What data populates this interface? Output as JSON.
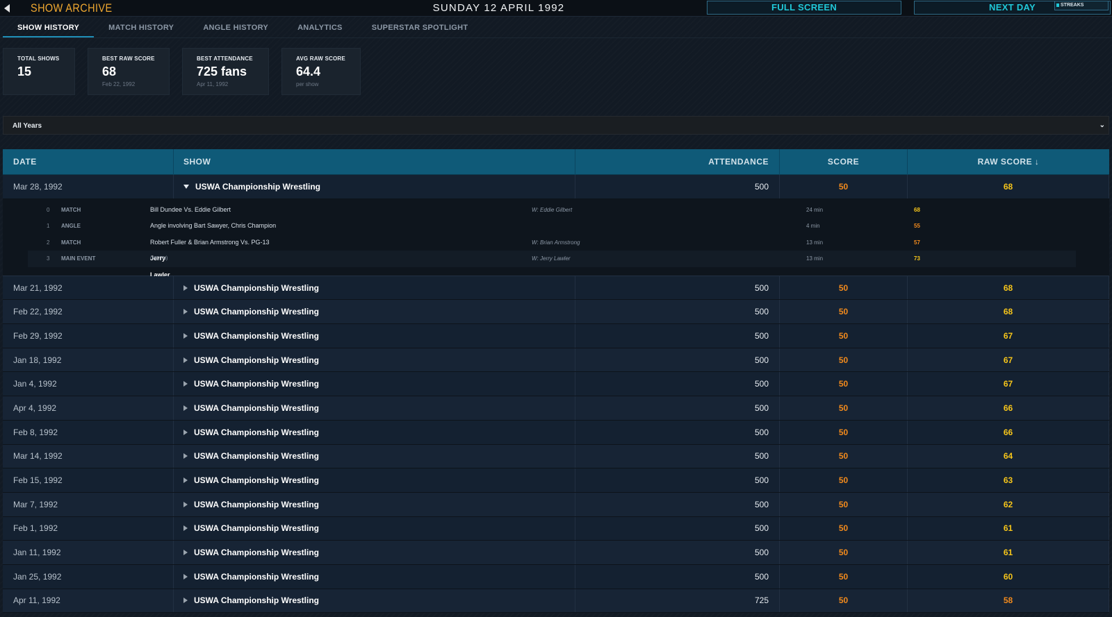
{
  "topbar": {
    "title": "SHOW ARCHIVE",
    "date": "SUNDAY 12 APRIL 1992",
    "full_screen_label": "FULL SCREEN",
    "next_day_label": "NEXT DAY",
    "streaks_label": "STREAKS"
  },
  "tabs": [
    {
      "label": "SHOW HISTORY",
      "active": true
    },
    {
      "label": "MATCH HISTORY"
    },
    {
      "label": "ANGLE HISTORY"
    },
    {
      "label": "ANALYTICS"
    },
    {
      "label": "SUPERSTAR SPOTLIGHT"
    }
  ],
  "stats": [
    {
      "label": "TOTAL SHOWS",
      "value": "15",
      "sub": ""
    },
    {
      "label": "BEST RAW SCORE",
      "value": "68",
      "sub": "Feb 22, 1992"
    },
    {
      "label": "BEST ATTENDANCE",
      "value": "725 fans",
      "sub": "Apr 11, 1992"
    },
    {
      "label": "AVG RAW SCORE",
      "value": "64.4",
      "sub": "per show"
    }
  ],
  "filter": {
    "selected": "All Years"
  },
  "table": {
    "headers": {
      "date": "DATE",
      "show": "SHOW",
      "attendance": "ATTENDANCE",
      "score": "SCORE",
      "raw_score": "RAW SCORE ↓"
    },
    "expanded": {
      "date": "Mar 28, 1992",
      "show": "USWA Championship Wrestling",
      "attendance": "500",
      "score": "50",
      "raw": "68",
      "segments": [
        {
          "idx": "0",
          "type": "MATCH",
          "desc": "Bill Dundee Vs. Eddie Gilbert",
          "tag": "",
          "winner": "W: Eddie Gilbert",
          "duration": "24 min",
          "score": "68"
        },
        {
          "idx": "1",
          "type": "ANGLE",
          "desc": "Angle involving Bart Sawyer, Chris Champion",
          "tag": "",
          "winner": "",
          "duration": "4 min",
          "score": "55"
        },
        {
          "idx": "2",
          "type": "MATCH",
          "desc": "Robert Fuller & Brian Armstrong Vs. PG-13",
          "tag": "",
          "winner": "W: Brian Armstrong",
          "duration": "13 min",
          "score": "57"
        },
        {
          "idx": "3",
          "type": "MAIN EVENT",
          "desc": "Jerry Lawler Vs. Koko B. Ware",
          "tag": "(MOTN)",
          "winner": "W: Jerry Lawler",
          "duration": "13 min",
          "score": "73"
        }
      ]
    },
    "rows": [
      {
        "date": "Mar 21, 1992",
        "show": "USWA Championship Wrestling",
        "attendance": "500",
        "score": "50",
        "raw": "68"
      },
      {
        "date": "Feb 22, 1992",
        "show": "USWA Championship Wrestling",
        "attendance": "500",
        "score": "50",
        "raw": "68"
      },
      {
        "date": "Feb 29, 1992",
        "show": "USWA Championship Wrestling",
        "attendance": "500",
        "score": "50",
        "raw": "67"
      },
      {
        "date": "Jan 18, 1992",
        "show": "USWA Championship Wrestling",
        "attendance": "500",
        "score": "50",
        "raw": "67"
      },
      {
        "date": "Jan 4, 1992",
        "show": "USWA Championship Wrestling",
        "attendance": "500",
        "score": "50",
        "raw": "67"
      },
      {
        "date": "Apr 4, 1992",
        "show": "USWA Championship Wrestling",
        "attendance": "500",
        "score": "50",
        "raw": "66"
      },
      {
        "date": "Feb 8, 1992",
        "show": "USWA Championship Wrestling",
        "attendance": "500",
        "score": "50",
        "raw": "66"
      },
      {
        "date": "Mar 14, 1992",
        "show": "USWA Championship Wrestling",
        "attendance": "500",
        "score": "50",
        "raw": "64"
      },
      {
        "date": "Feb 15, 1992",
        "show": "USWA Championship Wrestling",
        "attendance": "500",
        "score": "50",
        "raw": "63"
      },
      {
        "date": "Mar 7, 1992",
        "show": "USWA Championship Wrestling",
        "attendance": "500",
        "score": "50",
        "raw": "62"
      },
      {
        "date": "Feb 1, 1992",
        "show": "USWA Championship Wrestling",
        "attendance": "500",
        "score": "50",
        "raw": "61"
      },
      {
        "date": "Jan 11, 1992",
        "show": "USWA Championship Wrestling",
        "attendance": "500",
        "score": "50",
        "raw": "61"
      },
      {
        "date": "Jan 25, 1992",
        "show": "USWA Championship Wrestling",
        "attendance": "500",
        "score": "50",
        "raw": "60"
      },
      {
        "date": "Apr 11, 1992",
        "show": "USWA Championship Wrestling",
        "attendance": "725",
        "score": "50",
        "raw": "58"
      }
    ]
  },
  "colors": {
    "accent_title": "#f0a830",
    "header_bg": "#0f5a78",
    "button_text": "#20c8d8",
    "score_orange": "#f28a1c",
    "raw_yellow": "#f6c51a"
  }
}
